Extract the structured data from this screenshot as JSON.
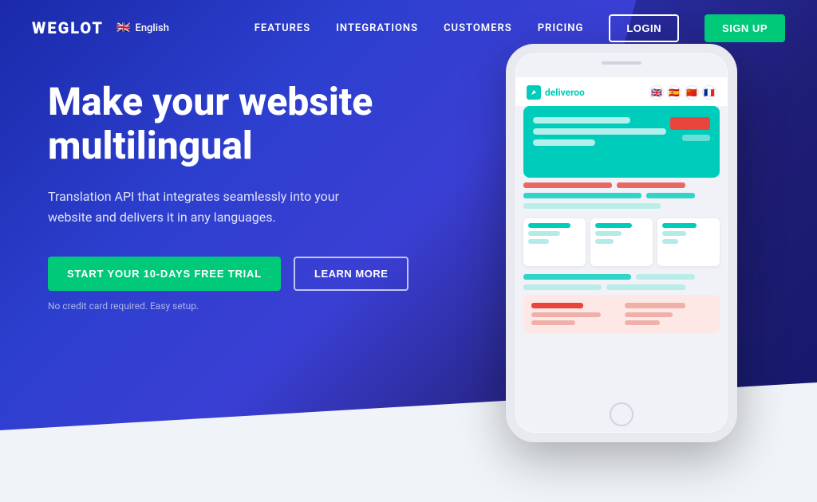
{
  "brand": {
    "name": "WEGLOT",
    "language": "English"
  },
  "nav": {
    "links": [
      {
        "id": "features",
        "label": "FEATURES"
      },
      {
        "id": "integrations",
        "label": "INTEGRATIONS"
      },
      {
        "id": "customers",
        "label": "CUSTOMERS"
      },
      {
        "id": "pricing",
        "label": "PRICING"
      }
    ],
    "login": "LOGIN",
    "signup": "SIGN UP"
  },
  "hero": {
    "title": "Make your website multilingual",
    "subtitle": "Translation API that integrates seamlessly into your website and delivers it in any languages.",
    "cta_trial": "START YOUR 10-DAYS FREE TRIAL",
    "cta_learn": "LEARN MORE",
    "note": "No credit card required. Easy setup."
  },
  "phone": {
    "brand": "deliveroo",
    "flags": [
      "🇬🇧",
      "🇪🇸",
      "🇨🇳",
      "🇫🇷"
    ]
  },
  "colors": {
    "primary": "#2d3fcf",
    "green": "#00c97a",
    "teal": "#00ccbc",
    "red": "#e8453c"
  }
}
